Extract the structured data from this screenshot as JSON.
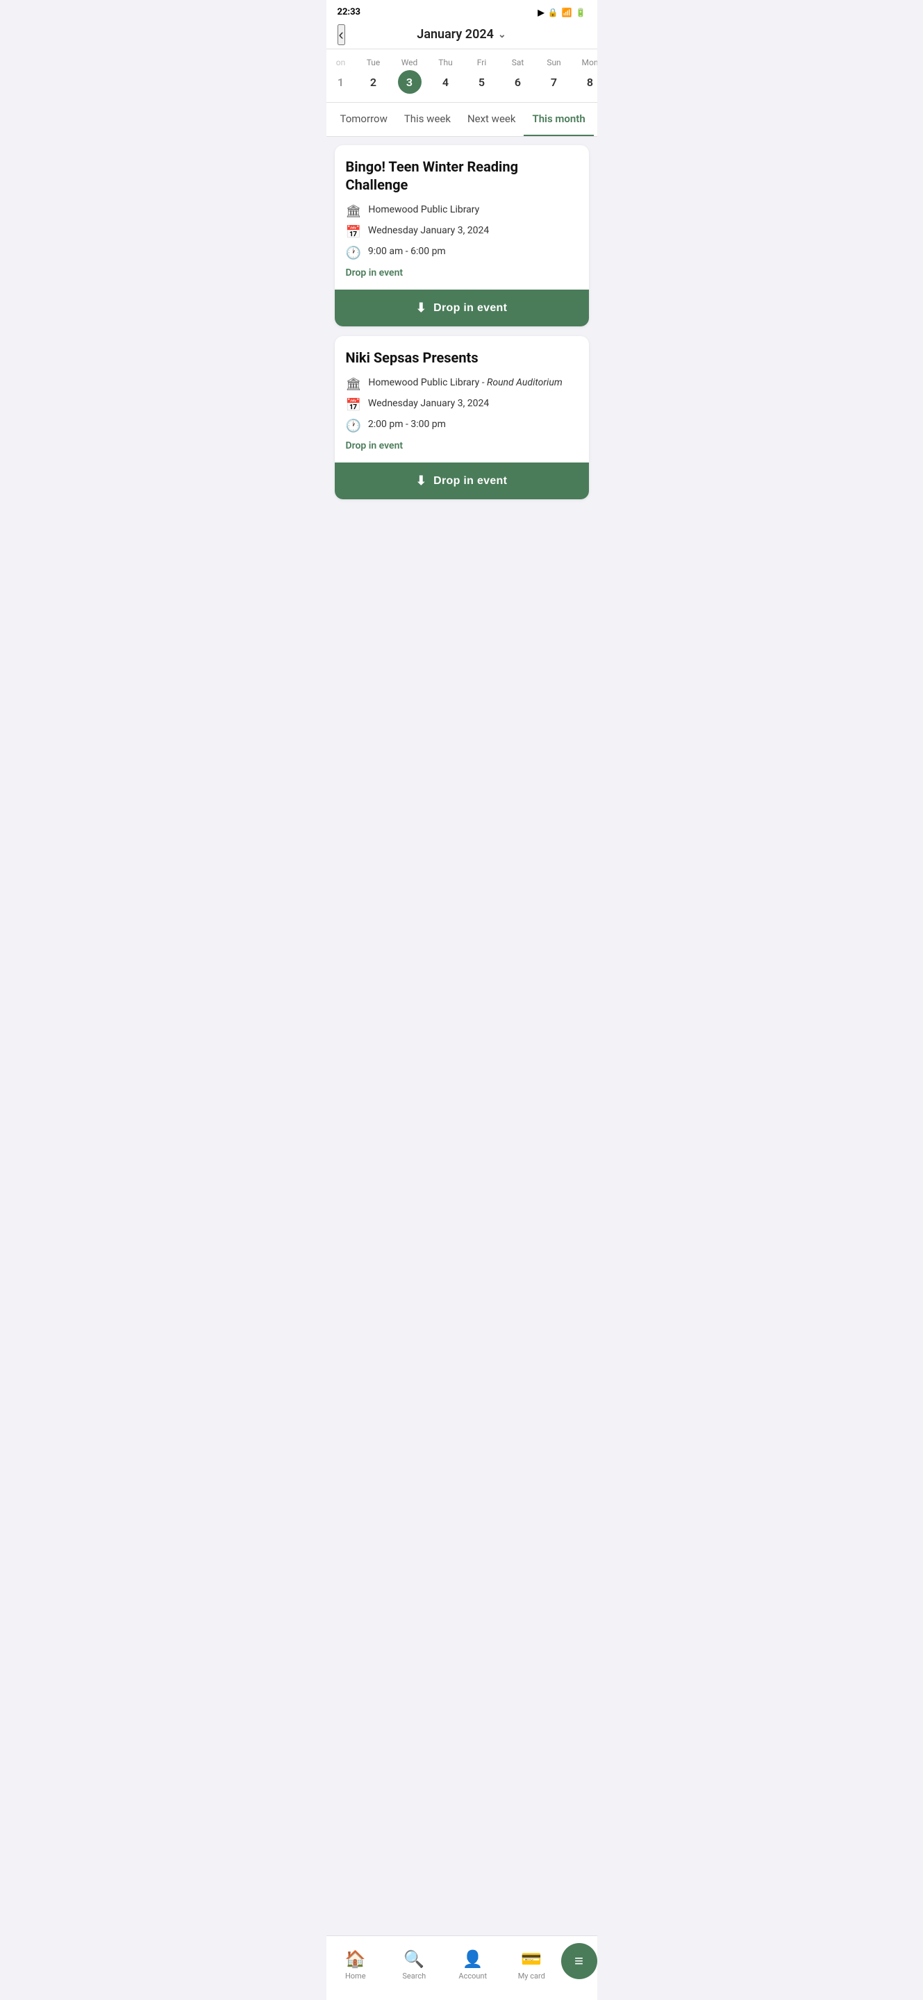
{
  "status": {
    "time": "22:33",
    "icons": "▶ 🔒 📶 🔋"
  },
  "header": {
    "back_label": "‹",
    "month_title": "January 2024",
    "chevron": "⌄"
  },
  "calendar": {
    "days": [
      {
        "label": "on",
        "num": "1",
        "active": false,
        "extra": true
      },
      {
        "label": "Tue",
        "num": "2",
        "active": false
      },
      {
        "label": "Wed",
        "num": "3",
        "active": true
      },
      {
        "label": "Thu",
        "num": "4",
        "active": false
      },
      {
        "label": "Fri",
        "num": "5",
        "active": false
      },
      {
        "label": "Sat",
        "num": "6",
        "active": false
      },
      {
        "label": "Sun",
        "num": "7",
        "active": false
      },
      {
        "label": "Mon",
        "num": "8",
        "active": false
      }
    ]
  },
  "filter_tabs": [
    {
      "label": "Tomorrow",
      "active": false
    },
    {
      "label": "This week",
      "active": false
    },
    {
      "label": "Next week",
      "active": false
    },
    {
      "label": "This month",
      "active": true
    }
  ],
  "events": [
    {
      "id": "event-1",
      "title": "Bingo! Teen Winter Reading Challenge",
      "location": "Homewood Public Library",
      "location_extra": "",
      "date": "Wednesday January 3, 2024",
      "time": "9:00 am - 6:00 pm",
      "drop_in_label": "Drop in event",
      "drop_in_button": "Drop in event"
    },
    {
      "id": "event-2",
      "title": "Niki Sepsas Presents",
      "location": "Homewood Public Library",
      "location_extra": "- Round Auditorium",
      "date": "Wednesday January 3, 2024",
      "time": "2:00 pm - 3:00 pm",
      "drop_in_label": "Drop in event",
      "drop_in_button": "Drop in event"
    }
  ],
  "bottom_nav": {
    "items": [
      {
        "id": "home",
        "icon": "🏠",
        "label": "Home"
      },
      {
        "id": "search",
        "icon": "🔍",
        "label": "Search"
      },
      {
        "id": "account",
        "icon": "👤",
        "label": "Account"
      },
      {
        "id": "mycard",
        "icon": "💳",
        "label": "My card"
      }
    ],
    "fab_icon": "≡"
  }
}
